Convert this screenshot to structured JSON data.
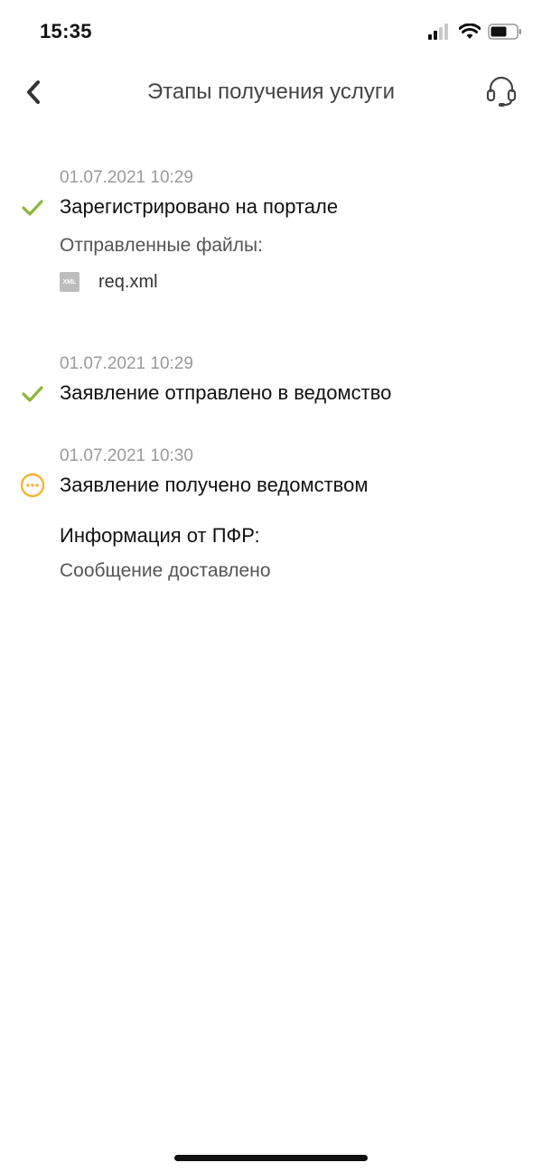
{
  "status_bar": {
    "time": "15:35",
    "signal_icon": "signal-bars-icon",
    "wifi_icon": "wifi-icon",
    "battery_icon": "battery-icon"
  },
  "nav": {
    "title": "Этапы получения услуги",
    "back_icon": "chevron-left-icon",
    "support_icon": "headset-icon"
  },
  "colors": {
    "done": "#8BB63A",
    "pending": "#F5B335",
    "muted": "#9a9a9a"
  },
  "stages": [
    {
      "date": "01.07.2021 10:29",
      "title": "Зарегистрировано на портале",
      "status": "done",
      "files_label": "Отправленные файлы:",
      "files": [
        {
          "type_label": "XML",
          "name": "req.xml"
        }
      ]
    },
    {
      "date": "01.07.2021 10:29",
      "title": "Заявление отправлено в ведомство",
      "status": "done"
    },
    {
      "date": "01.07.2021 10:30",
      "title": "Заявление получено ведомством",
      "status": "pending",
      "info_heading": "Информация от ПФР:",
      "info_text": "Сообщение доставлено"
    }
  ]
}
